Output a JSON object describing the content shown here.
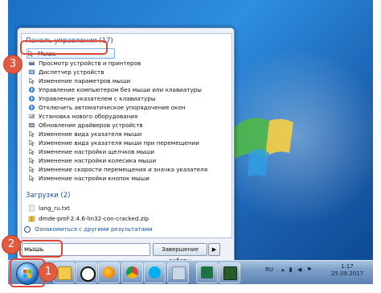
{
  "start_menu": {
    "programs_header": "Панель управления (17)",
    "items": [
      {
        "label": "Мышь",
        "icon": "mouse-icon"
      },
      {
        "label": "Просмотр устройств и принтеров",
        "icon": "printer-icon"
      },
      {
        "label": "Диспетчер устройств",
        "icon": "device-manager-icon"
      },
      {
        "label": "Изменение параметров мыши",
        "icon": "mouse-icon"
      },
      {
        "label": "Управление компьютером без мыши или клавиатуры",
        "icon": "accessibility-icon"
      },
      {
        "label": "Управление указателем с клавиатуры",
        "icon": "accessibility-icon"
      },
      {
        "label": "Отключить автоматическое упорядочение окон",
        "icon": "accessibility-icon"
      },
      {
        "label": "Установка нового оборудования",
        "icon": "hardware-icon"
      },
      {
        "label": "Обновление драйверов устройств",
        "icon": "driver-icon"
      },
      {
        "label": "Изменение вида указателя мыши",
        "icon": "mouse-icon"
      },
      {
        "label": "Изменение вида указателя мыши при перемещении",
        "icon": "mouse-icon"
      },
      {
        "label": "Изменение настройки щелчков мыши",
        "icon": "mouse-icon"
      },
      {
        "label": "Изменение настройки колесика мыши",
        "icon": "mouse-icon"
      },
      {
        "label": "Изменение скорости перемещения и значка указателя",
        "icon": "mouse-icon"
      },
      {
        "label": "Изменение настройки кнопок мыши",
        "icon": "mouse-icon"
      }
    ],
    "files_header": "Загрузки (2)",
    "files": [
      {
        "label": "lang_ru.txt",
        "icon": "text-file-icon"
      },
      {
        "label": "dmde-prof-2.4.6-lin32-con-cracked.zip",
        "icon": "zip-file-icon"
      }
    ],
    "more_results": "Ознакомиться с другими результатами",
    "search_value": "мышь",
    "shutdown_label": "Завершение работы",
    "shutdown_arrow": "▶"
  },
  "taskbar": {
    "lang": "RU",
    "time": "1:17",
    "date": "25.09.2017"
  },
  "callouts": {
    "one": "1",
    "two": "2",
    "three": "3"
  },
  "colors": {
    "accent": "#1d4fa0",
    "callout": "#e25a3f",
    "highlight": "#e0483a"
  }
}
